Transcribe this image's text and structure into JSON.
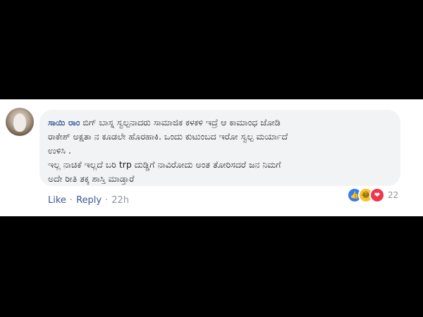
{
  "comment": {
    "author": "ಸಾಯಿ ರಾಂ",
    "lines": [
      "ಬಿಗ್ ಬಾಸ್ನ ಸ್ವಲ್ಪನಾದರು ಸಾಮಾಜಿಕ ಕಳಕಳಿ ಇದ್ರೆ ಆ ಕಾಮಾಂಧ ಜೋಡಿ",
      "ರಾಕೇಶ್ ಅಕ್ಷತಾ ನ ಕೂಡಲೇ ಹೊರಹಾಕಿ. ಒಂದು ಕುಟುಂಬದ ಇರೋ ಸ್ವಲ್ಪ ಮರ್ಯಾದೆ",
      "ಉಳಿಸಿ .",
      "ಇಲ್ಲ ನಾಚಿಕೆ ಇಲ್ಲದೆ ಬರಿ trp ದುಡ್ಡಿಗೆ ನಾವಿರೋದು ಅಂತ ತೋರಿಸದರೆ ಜನ ನಿಮಗೆ",
      "ಅದೇ ರೀತಿ ತಕ್ಕ ಶಾಸ್ತಿ ಮಾಡ್ತಾರೆ"
    ],
    "reaction_count": "22",
    "reactions": [
      "like-icon",
      "haha-icon",
      "love-icon"
    ]
  },
  "actions": {
    "like": "Like",
    "separator": "·",
    "reply": "Reply",
    "time": "22h"
  },
  "colors": {
    "author": "#385898",
    "bubble": "#f2f3f5",
    "background": "#000000"
  }
}
